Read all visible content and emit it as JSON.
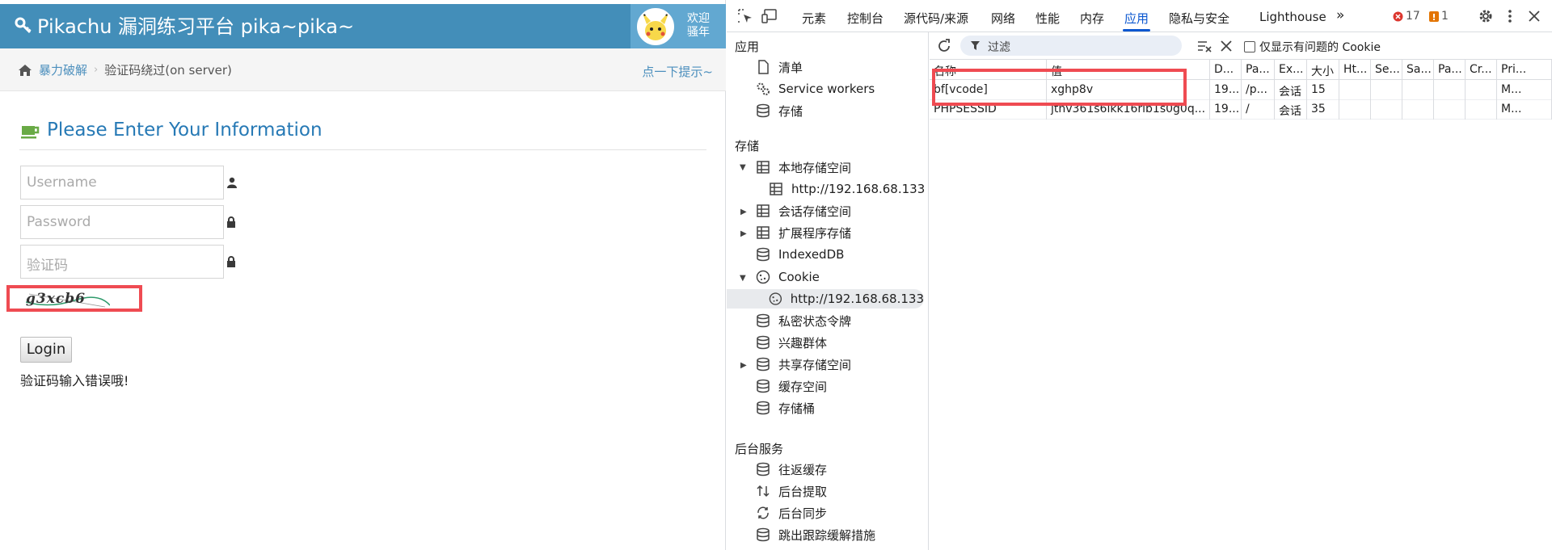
{
  "site": {
    "title": "Pikachu 漏洞练习平台 pika~pika~",
    "welcome_line1": "欢迎",
    "welcome_line2": "骚年",
    "breadcrumb": {
      "parent": "暴力破解",
      "current": "验证码绕过(on server)"
    },
    "hint_link": "点一下提示~",
    "page_title": "Please Enter Your Information",
    "form": {
      "username_placeholder": "Username",
      "password_placeholder": "Password",
      "vcode_placeholder": "验证码",
      "captcha_text": "g3xcb6",
      "login_label": "Login",
      "error_message": "验证码输入错误哦!"
    }
  },
  "devtools": {
    "tabs": [
      "元素",
      "控制台",
      "源代码/来源",
      "网络",
      "性能",
      "内存",
      "应用",
      "隐私与安全",
      "Lighthouse"
    ],
    "active_tab": "应用",
    "overflow": "»",
    "error_count": "17",
    "warning_count": "1",
    "sidebar": {
      "section_app": "应用",
      "app_items": [
        "清单",
        "Service workers",
        "存储"
      ],
      "section_storage": "存储",
      "local_storage": "本地存储空间",
      "local_origin": "http://192.168.68.133",
      "session_storage": "会话存储空间",
      "extension_storage": "扩展程序存储",
      "indexeddb": "IndexedDB",
      "cookie": "Cookie",
      "cookie_origin": "http://192.168.68.133",
      "private_state": "私密状态令牌",
      "interest_groups": "兴趣群体",
      "shared_storage": "共享存储空间",
      "cache_storage": "缓存空间",
      "storage_buckets": "存储桶",
      "section_bg": "后台服务",
      "bfcache": "往返缓存",
      "bg_fetch": "后台提取",
      "bg_sync": "后台同步",
      "bounce": "跳出跟踪缓解措施"
    },
    "filter_placeholder": "过滤",
    "only_issues_label": "仅显示有问题的 Cookie",
    "columns": [
      "名称",
      "值",
      "D...",
      "Pa...",
      "Ex...",
      "大小",
      "Ht...",
      "Se...",
      "Sa...",
      "Pa...",
      "Cr...",
      "Pri..."
    ],
    "rows": [
      [
        "bf[vcode]",
        "xghp8v",
        "19...",
        "/p...",
        "会话",
        "15",
        "",
        "",
        "",
        "",
        "",
        "M..."
      ],
      [
        "PHPSESSID",
        "jtnv361s6lkk16rlb1s0g0q...",
        "19...",
        "/",
        "会话",
        "35",
        "",
        "",
        "",
        "",
        "",
        "M..."
      ]
    ]
  },
  "colors": {
    "navbar": "#438eb9",
    "accent": "#0b57d0",
    "highlight": "#ef4b52"
  }
}
